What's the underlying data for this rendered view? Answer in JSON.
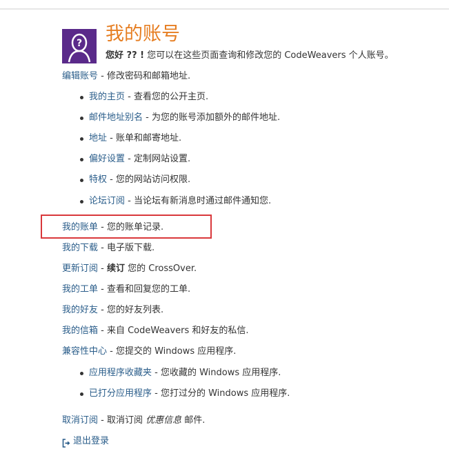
{
  "header": {
    "title": "我的账号",
    "greeting_bold": "您好 ?? !",
    "greeting_rest": "您可以在这些页面查询和修改您的 CodeWeavers 个人账号。"
  },
  "account_links": {
    "edit_account": {
      "label": "编辑账号",
      "desc": " - 修改密码和邮箱地址."
    },
    "sub_items": [
      {
        "label": "我的主页",
        "desc": " - 查看您的公开主页."
      },
      {
        "label": "邮件地址别名",
        "desc": " - 为您的账号添加额外的邮件地址."
      },
      {
        "label": "地址",
        "desc": " - 账单和邮寄地址."
      },
      {
        "label": "偏好设置",
        "desc": " - 定制网站设置."
      },
      {
        "label": "特权",
        "desc": " - 您的网站访问权限."
      },
      {
        "label": "论坛订阅",
        "desc": " - 当论坛有新消息时通过邮件通知您."
      }
    ]
  },
  "main_links": [
    {
      "label": "我的账单",
      "desc": " - 您的账单记录."
    },
    {
      "label": "我的下载",
      "desc": " - 电子版下载."
    }
  ],
  "renew": {
    "label": "更新订阅",
    "sep": " - ",
    "bold": "续订",
    "rest": " 您的 CrossOver."
  },
  "more_links": [
    {
      "label": "我的工单",
      "desc": " - 查看和回复您的工单."
    },
    {
      "label": "我的好友",
      "desc": " - 您的好友列表."
    },
    {
      "label": "我的信箱",
      "desc": " - 来自 CodeWeavers 和好友的私信."
    },
    {
      "label": "兼容性中心",
      "desc": " - 您提交的 Windows 应用程序."
    }
  ],
  "compat_sub_items": [
    {
      "label": "应用程序收藏夹",
      "desc": " - 您收藏的 Windows 应用程序."
    },
    {
      "label": "已打分应用程序",
      "desc": " - 您打过分的 Windows 应用程序."
    }
  ],
  "unsubscribe": {
    "label": "取消订阅",
    "sep": " - 取消订阅 ",
    "italic": "优惠信息",
    "rest": " 邮件."
  },
  "logout": {
    "label": "退出登录",
    "icon": "sign-out-icon"
  },
  "colors": {
    "accent_title": "#e67e22",
    "link": "#2a5d8a",
    "avatar_bg": "#5a2a8a",
    "highlight_border": "#d9373a"
  }
}
